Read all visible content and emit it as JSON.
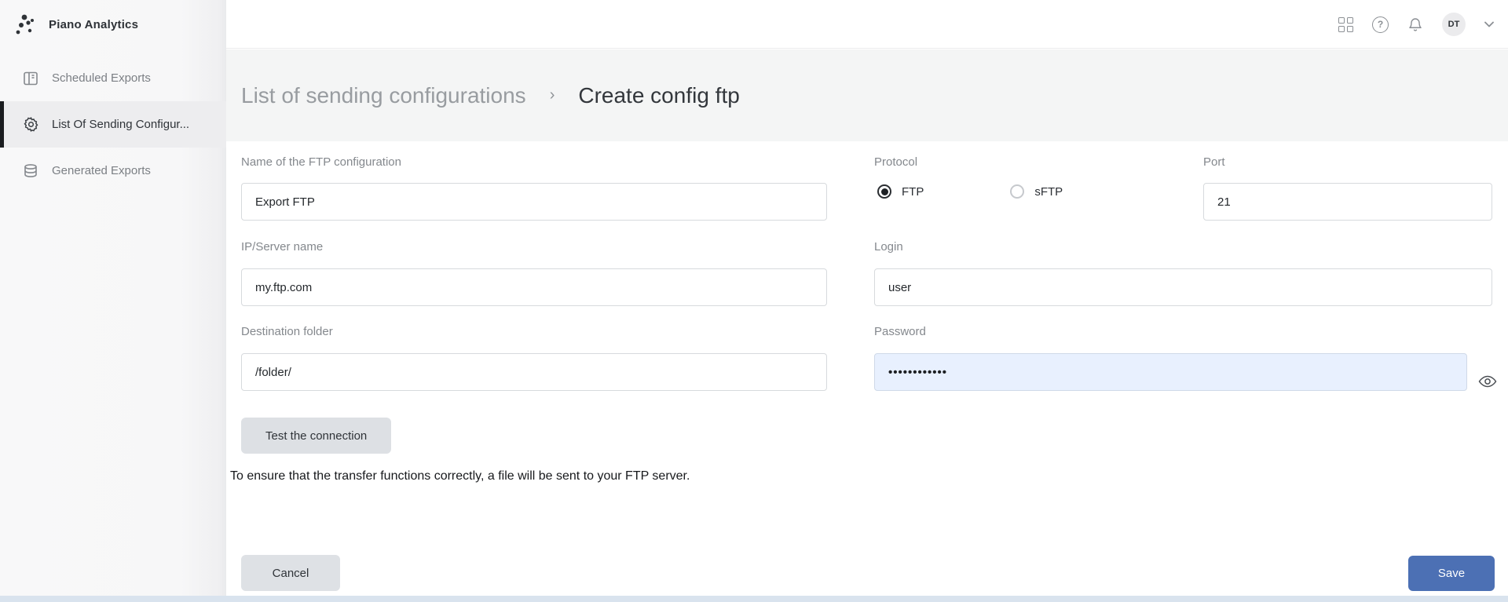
{
  "app": {
    "name": "Piano Analytics"
  },
  "sidebar": {
    "items": [
      {
        "label": "Scheduled Exports",
        "icon": "book-icon",
        "selected": false
      },
      {
        "label": "List Of Sending Configur...",
        "icon": "gear-icon",
        "selected": true
      },
      {
        "label": "Generated Exports",
        "icon": "database-icon",
        "selected": false
      }
    ]
  },
  "topbar": {
    "icons": [
      "apps-grid-icon",
      "help-icon",
      "notifications-bell-icon",
      "chevron-down-icon"
    ],
    "help_glyph": "?",
    "avatar_initials": "DT"
  },
  "breadcrumb": {
    "parent": "List of sending configurations",
    "separator": "›",
    "current": "Create config ftp"
  },
  "form": {
    "name": {
      "label": "Name of the FTP configuration",
      "value": "Export FTP"
    },
    "protocol": {
      "label": "Protocol",
      "options": [
        {
          "label": "FTP",
          "selected": true
        },
        {
          "label": "sFTP",
          "selected": false
        }
      ]
    },
    "port": {
      "label": "Port",
      "value": "21"
    },
    "ip": {
      "label": "IP/Server name",
      "value": "my.ftp.com"
    },
    "login": {
      "label": "Login",
      "value": "user"
    },
    "destination": {
      "label": "Destination folder",
      "value": "/folder/"
    },
    "password": {
      "label": "Password",
      "masked_value": "••••••••••••"
    },
    "test_button": "Test the connection",
    "note": "To ensure that the transfer functions correctly, a file will be sent to your FTP server.",
    "cancel_button": "Cancel",
    "save_button": "Save"
  },
  "colors": {
    "accent_save": "#4c70b4",
    "password_autofill_bg": "#e8f0fe",
    "sidebar_bg": "#f7f7f8",
    "breadcrumb_band_bg": "#f4f5f5",
    "selected_item_border": "#1a1c1f"
  }
}
